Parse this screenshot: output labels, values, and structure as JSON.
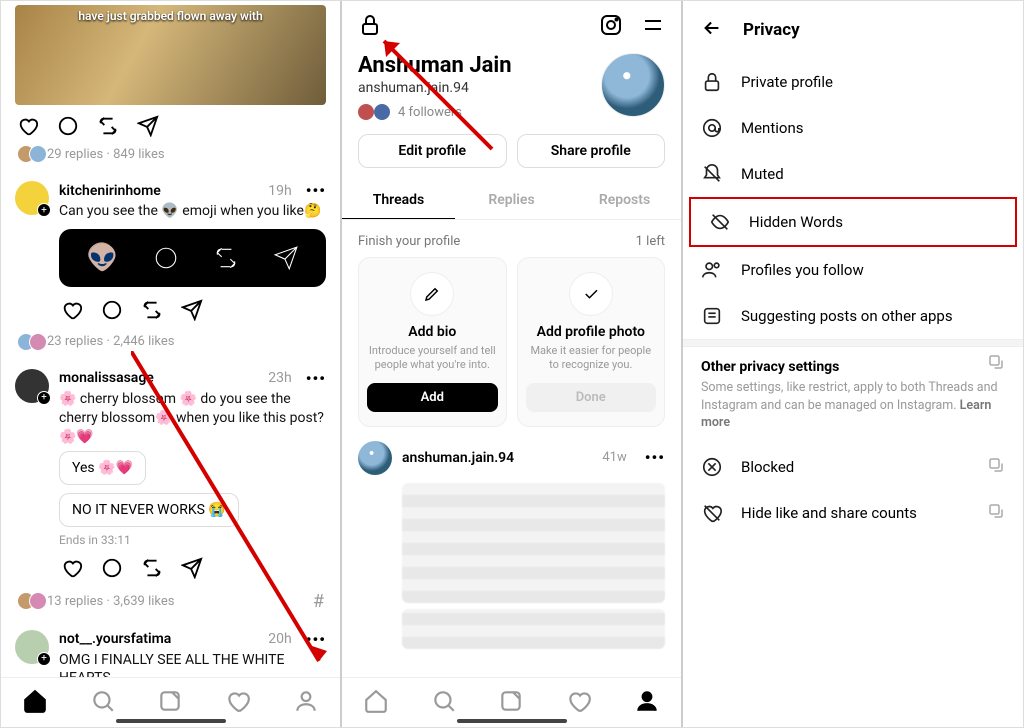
{
  "pane1": {
    "top_image_caption": "have just grabbed flown away with",
    "post1_meta": "29 replies · 849 likes",
    "reply1": {
      "user": "kitchenirinhome",
      "time": "19h",
      "text_pre": "Can you see the ",
      "text_post": " emoji when you like"
    },
    "reply1_meta": "23 replies · 2,446 likes",
    "reply2": {
      "user": "monalissasage",
      "time": "23h",
      "text": "🌸 cherry blossom 🌸 do you see the cherry blossom🌸 when you like this post? 🌸💗",
      "poll_a": "Yes 🌸💗",
      "poll_b": "NO IT NEVER WORKS 😭",
      "ends": "Ends in 33:11"
    },
    "reply2_meta": "13 replies · 3,639 likes",
    "reply3": {
      "user": "not__.yoursfatima",
      "time": "20h",
      "text": "OMG I FINALLY SEE ALL THE WHITE HEARTS"
    }
  },
  "pane2": {
    "name": "Anshuman Jain",
    "handle": "anshuman.jain.94",
    "followers": "4 followers",
    "edit": "Edit profile",
    "share": "Share profile",
    "tabs": {
      "threads": "Threads",
      "replies": "Replies",
      "reposts": "Reposts"
    },
    "finish_label": "Finish your profile",
    "finish_left": "1 left",
    "card_bio": {
      "title": "Add bio",
      "sub": "Introduce yourself and tell people what you're into.",
      "btn": "Add"
    },
    "card_photo": {
      "title": "Add profile photo",
      "sub": "Make it easier for people to recognize you.",
      "btn": "Done"
    },
    "post": {
      "user": "anshuman.jain.94",
      "time": "41w"
    }
  },
  "pane3": {
    "title": "Privacy",
    "items": {
      "private": "Private profile",
      "mentions": "Mentions",
      "muted": "Muted",
      "hidden": "Hidden Words",
      "follow": "Profiles you follow",
      "suggest": "Suggesting posts on other apps"
    },
    "other": {
      "title": "Other privacy settings",
      "sub": "Some settings, like restrict, apply to both Threads and Instagram and can be managed on Instagram. ",
      "learn": "Learn more"
    },
    "blocked": "Blocked",
    "hide": "Hide like and share counts"
  }
}
